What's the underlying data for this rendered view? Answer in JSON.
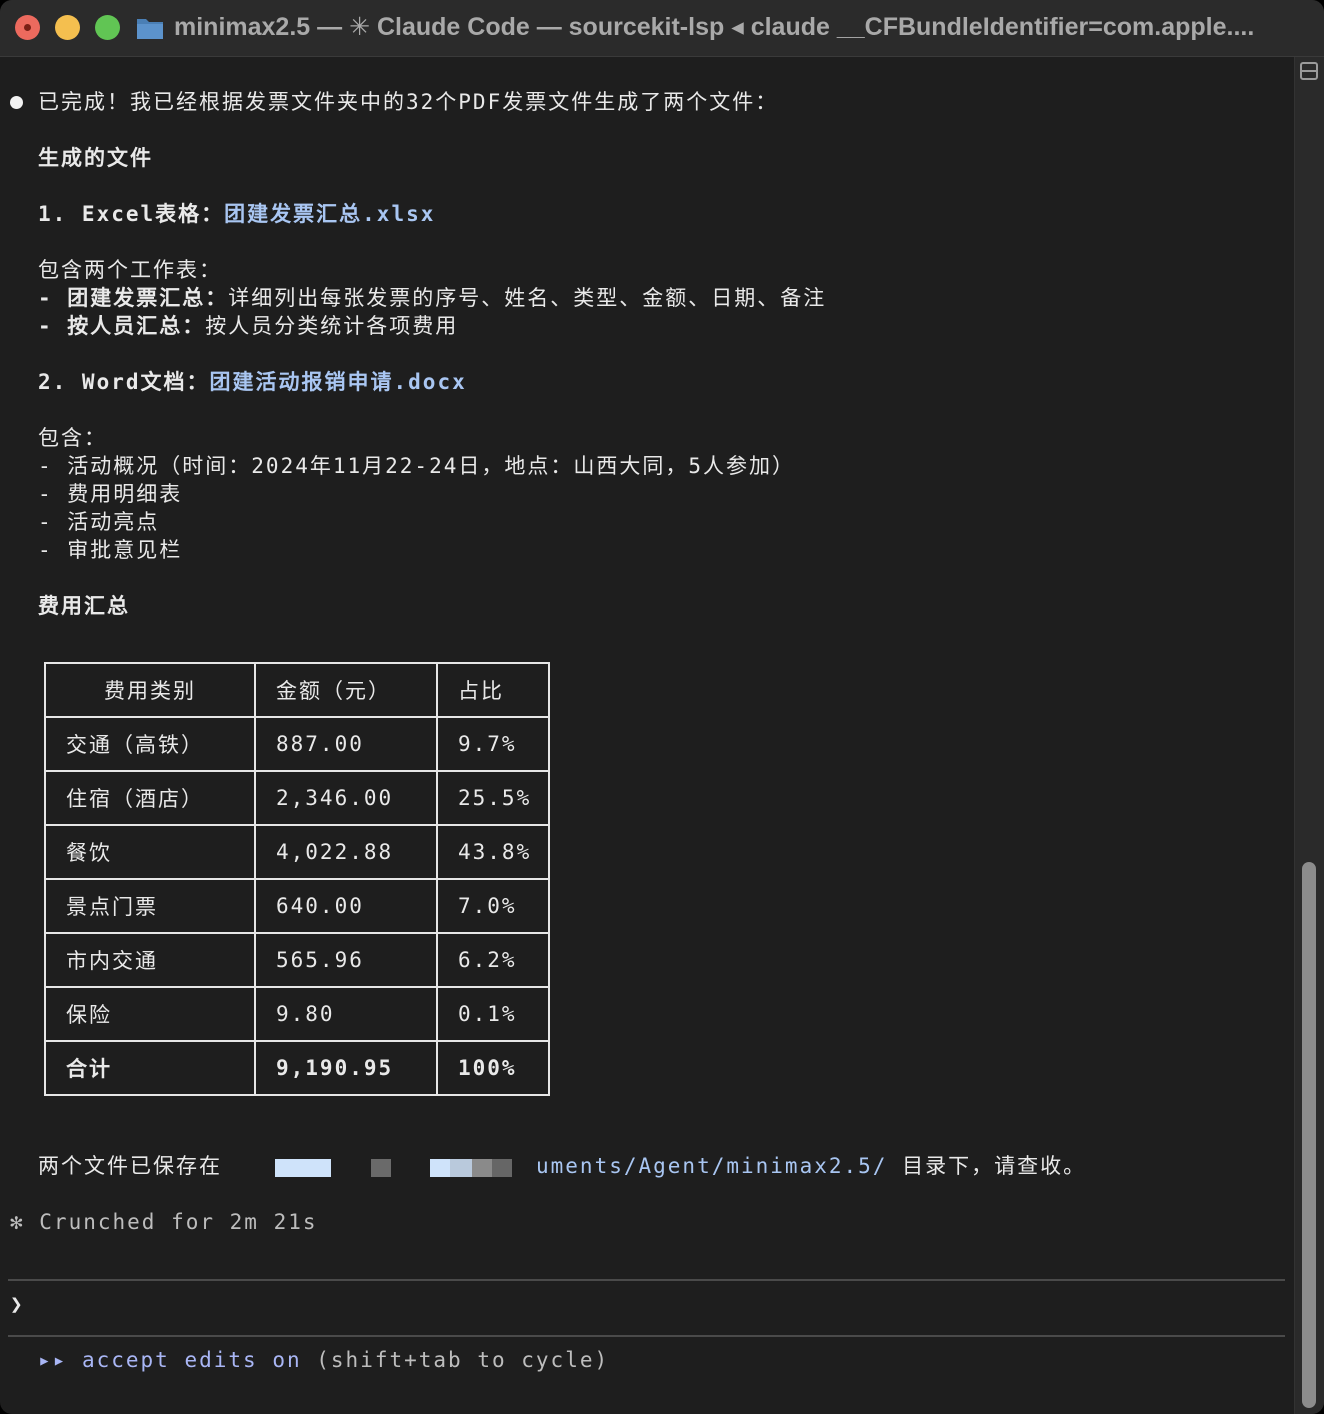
{
  "window": {
    "title": "minimax2.5 — ✳ Claude Code — sourcekit-lsp ◂ claude __CFBundleIdentifier=com.apple...."
  },
  "output": {
    "intro": "已完成！我已经根据发票文件夹中的32个PDF发票文件生成了两个文件：",
    "generated_heading": "生成的文件",
    "item1_prefix": "1. Excel表格：",
    "item1_file": "团建发票汇总.xlsx",
    "item1_contains": "包含两个工作表：",
    "item1_sheets": [
      {
        "name": "- 团建发票汇总：",
        "desc": "详细列出每张发票的序号、姓名、类型、金额、日期、备注"
      },
      {
        "name": "- 按人员汇总：",
        "desc": "按人员分类统计各项费用"
      }
    ],
    "item2_prefix": "2. Word文档：",
    "item2_file": "团建活动报销申请.docx",
    "item2_contains": "包含：",
    "item2_points": [
      "- 活动概况（时间：2024年11月22-24日，地点：山西大同，5人参加）",
      "- 费用明细表",
      "- 活动亮点",
      "- 审批意见栏"
    ],
    "summary_heading": "费用汇总",
    "table": {
      "headers": [
        "费用类别",
        "金额（元）",
        "占比"
      ],
      "rows": [
        [
          "交通（高铁）",
          "887.00",
          "9.7%"
        ],
        [
          "住宿（酒店）",
          "2,346.00",
          "25.5%"
        ],
        [
          "餐饮",
          "4,022.88",
          "43.8%"
        ],
        [
          "景点门票",
          "640.00",
          "7.0%"
        ],
        [
          "市内交通",
          "565.96",
          "6.2%"
        ],
        [
          "保险",
          "9.80",
          "0.1%"
        ]
      ],
      "total": [
        "合计",
        "9,190.95",
        "100%"
      ]
    },
    "saved_prefix": "两个文件已保存在",
    "saved_path": "uments/Agent/minimax2.5/",
    "saved_suffix": " 目录下，请查收。",
    "crunched": "✻ Crunched for 2m 21s"
  },
  "prompt": {
    "marker": "❯",
    "mode_arrows": "▸▸",
    "mode_label": "accept edits on",
    "mode_hint": "(shift+tab to cycle)"
  },
  "colors": {
    "background": "#1e1e1e",
    "link": "#a9c6f2",
    "accent": "#a9b6f5"
  }
}
